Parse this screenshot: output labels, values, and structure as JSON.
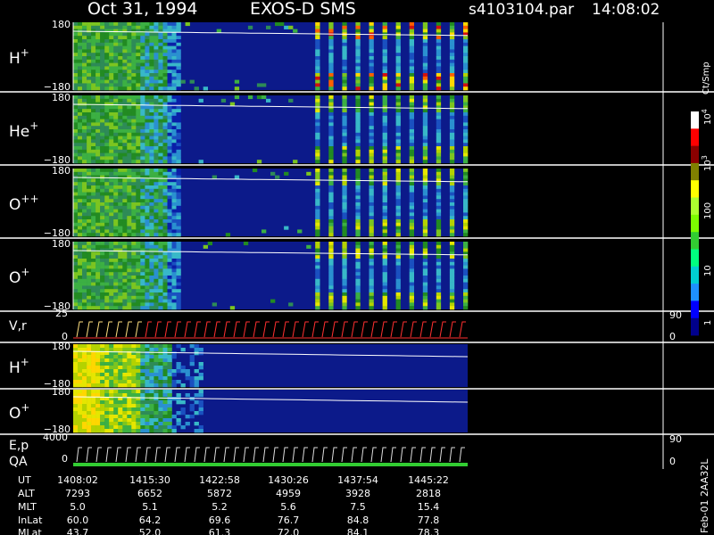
{
  "header": {
    "date": "Oct 31, 1994",
    "instrument": "EXOS-D SMS",
    "file": "s4103104.par",
    "time": "14:08:02"
  },
  "colorbar": {
    "unit_label": "Ct/Smp",
    "ticks": [
      "1",
      "10",
      "100",
      "10",
      "10"
    ],
    "tick_exponents": [
      "",
      "",
      "",
      "3",
      "4"
    ],
    "colors": [
      "#00008b",
      "#0000ff",
      "#1e90ff",
      "#00ced1",
      "#00ff7f",
      "#32cd32",
      "#7cfc00",
      "#adff2f",
      "#ffff00",
      "#808000",
      "#8b0000",
      "#ff0000",
      "#ffffff"
    ]
  },
  "side_label": "Feb-01 2AA32L",
  "panels": [
    {
      "id": "h-plus",
      "label": "H",
      "superscript": "+",
      "y_top": "180",
      "y_bottom": "−180",
      "rows": 14,
      "seed": 3,
      "cutoff": 18
    },
    {
      "id": "he-plus",
      "label": "He",
      "superscript": "+",
      "y_top": "180",
      "y_bottom": "−180",
      "rows": 14,
      "seed": 7,
      "cutoff": 18
    },
    {
      "id": "o-plusplus",
      "label": "O",
      "superscript": "++",
      "y_top": "180",
      "y_bottom": "−180",
      "rows": 14,
      "seed": 11,
      "cutoff": 18
    },
    {
      "id": "o-plus",
      "label": "O",
      "superscript": "+",
      "y_top": "180",
      "y_bottom": "−180",
      "rows": 14,
      "seed": 13,
      "cutoff": 18
    }
  ],
  "vr_panel": {
    "label": "V,r",
    "y_top": "25",
    "y_bottom": "0",
    "right_top": "90",
    "right_bottom": "0"
  },
  "lower_panels": [
    {
      "id": "h-plus-2",
      "label": "H",
      "superscript": "+",
      "y_top": "180",
      "y_bottom": "−180",
      "seed": 17
    },
    {
      "id": "o-plus-2",
      "label": "O",
      "superscript": "+",
      "y_top": "180",
      "y_bottom": "−180",
      "seed": 19
    }
  ],
  "ep_panel": {
    "label": "E,p",
    "label2": "QA",
    "y_top": "4000",
    "y_bottom": "0",
    "right_top": "90",
    "right_bottom": "0"
  },
  "ephemeris": {
    "row_labels": [
      "UT",
      "ALT",
      "MLT",
      "InLat",
      "MLat"
    ],
    "columns": [
      [
        "1408:02",
        "7293",
        "5.0",
        "60.0",
        "43.7"
      ],
      [
        "1415:30",
        "6652",
        "5.1",
        "64.2",
        "52.0"
      ],
      [
        "1422:58",
        "5872",
        "5.2",
        "69.6",
        "61.3"
      ],
      [
        "1430:26",
        "4959",
        "5.6",
        "76.7",
        "72.0"
      ],
      [
        "1437:54",
        "3928",
        "7.5",
        "84.8",
        "84.1"
      ],
      [
        "1445:22",
        "2818",
        "15.4",
        "77.8",
        "78.3"
      ]
    ]
  },
  "chart_data": {
    "type": "heatmap",
    "title": "Oct 31, 1994   EXOS-D SMS",
    "x_ticks_ut": [
      "1408:02",
      "1415:30",
      "1422:58",
      "1430:26",
      "1437:54",
      "1445:22"
    ],
    "y_range_pitch": [
      -180,
      180
    ],
    "colorscale_range": [
      1,
      10000
    ],
    "colorscale": "log",
    "series": [
      {
        "name": "H+"
      },
      {
        "name": "He+"
      },
      {
        "name": "O++"
      },
      {
        "name": "O+"
      },
      {
        "name": "V,r"
      },
      {
        "name": "H+"
      },
      {
        "name": "O+"
      },
      {
        "name": "E,p"
      }
    ]
  }
}
